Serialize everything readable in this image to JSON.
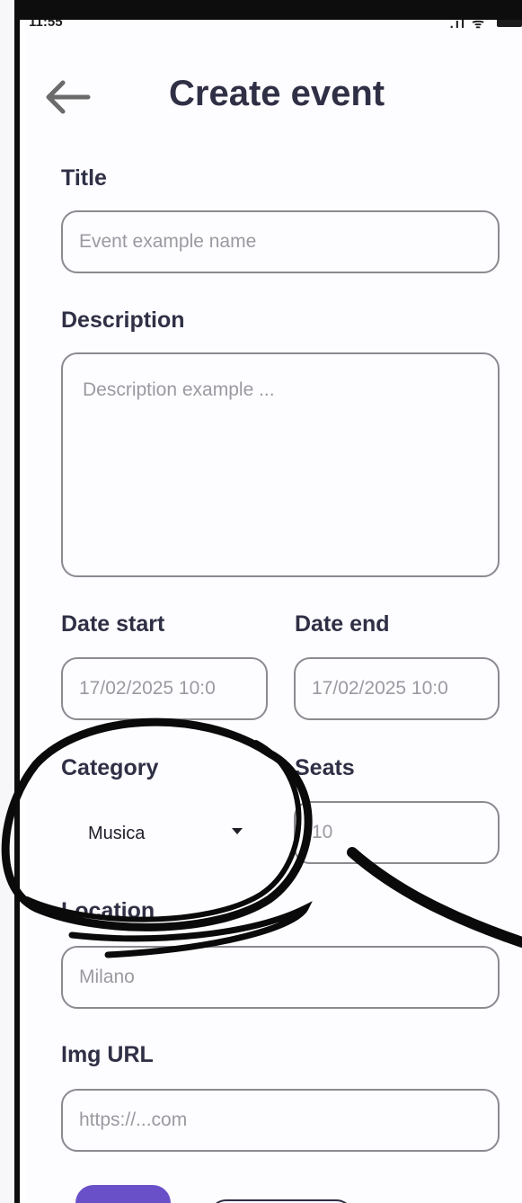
{
  "status_bar": {
    "time": "11:55"
  },
  "header": {
    "title": "Create event"
  },
  "form": {
    "title_label": "Title",
    "title_placeholder": "Event example name",
    "description_label": "Description",
    "description_placeholder": "Description example ...",
    "date_start_label": "Date start",
    "date_start_value": "17/02/2025 10:0",
    "date_end_label": "Date end",
    "date_end_value": "17/02/2025 10:0",
    "category_label": "Category",
    "category_value": "Musica",
    "seats_label": "Seats",
    "seats_placeholder": "10",
    "location_label": "Location",
    "location_placeholder": "Milano",
    "img_url_label": "Img URL",
    "img_url_placeholder": "https://...com"
  },
  "icons": {
    "back": "arrow-left-icon",
    "dropdown": "caret-down-icon"
  },
  "colors": {
    "text_dark": "#2f2f45",
    "border": "#8a8a90",
    "accent": "#6a50c8"
  }
}
